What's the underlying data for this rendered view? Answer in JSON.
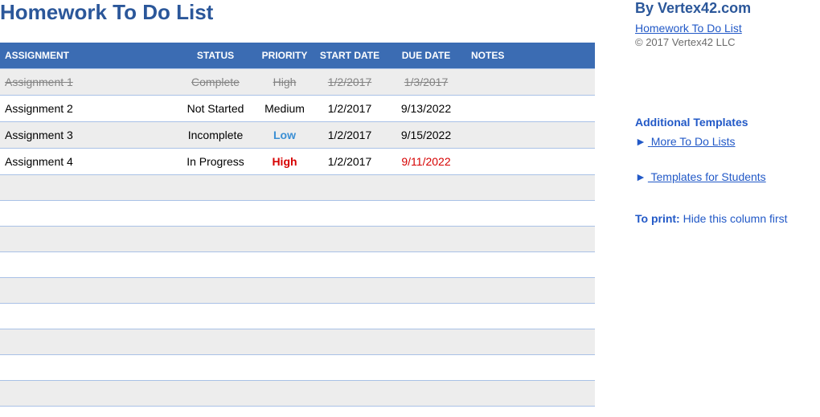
{
  "title": "Homework To Do List",
  "columns": {
    "assignment": "Assignment",
    "status": "Status",
    "priority": "Priority",
    "start_date": "Start Date",
    "due_date": "Due Date",
    "notes": "Notes"
  },
  "rows": [
    {
      "assignment": "Assignment 1",
      "status": "Complete",
      "priority": "High",
      "start_date": "1/2/2017",
      "due_date": "1/3/2017",
      "notes": "",
      "done": true,
      "priority_style": "",
      "due_style": ""
    },
    {
      "assignment": "Assignment 2",
      "status": "Not Started",
      "priority": "Medium",
      "start_date": "1/2/2017",
      "due_date": "9/13/2022",
      "notes": "",
      "done": false,
      "priority_style": "",
      "due_style": ""
    },
    {
      "assignment": "Assignment 3",
      "status": "Incomplete",
      "priority": "Low",
      "start_date": "1/2/2017",
      "due_date": "9/15/2022",
      "notes": "",
      "done": false,
      "priority_style": "prio-low",
      "due_style": ""
    },
    {
      "assignment": "Assignment 4",
      "status": "In Progress",
      "priority": "High",
      "start_date": "1/2/2017",
      "due_date": "9/11/2022",
      "notes": "",
      "done": false,
      "priority_style": "prio-high-red",
      "due_style": "due-red"
    }
  ],
  "empty_rows": 9,
  "sidebar": {
    "by": "By Vertex42.com",
    "title_link": "Homework To Do List",
    "copyright": "© 2017 Vertex42 LLC",
    "additional_heading": "Additional Templates",
    "more_lists": "More To Do Lists",
    "templates_students": "Templates for Students",
    "print_label": "To print:",
    "print_text": " Hide this column first",
    "arrow": "►"
  }
}
